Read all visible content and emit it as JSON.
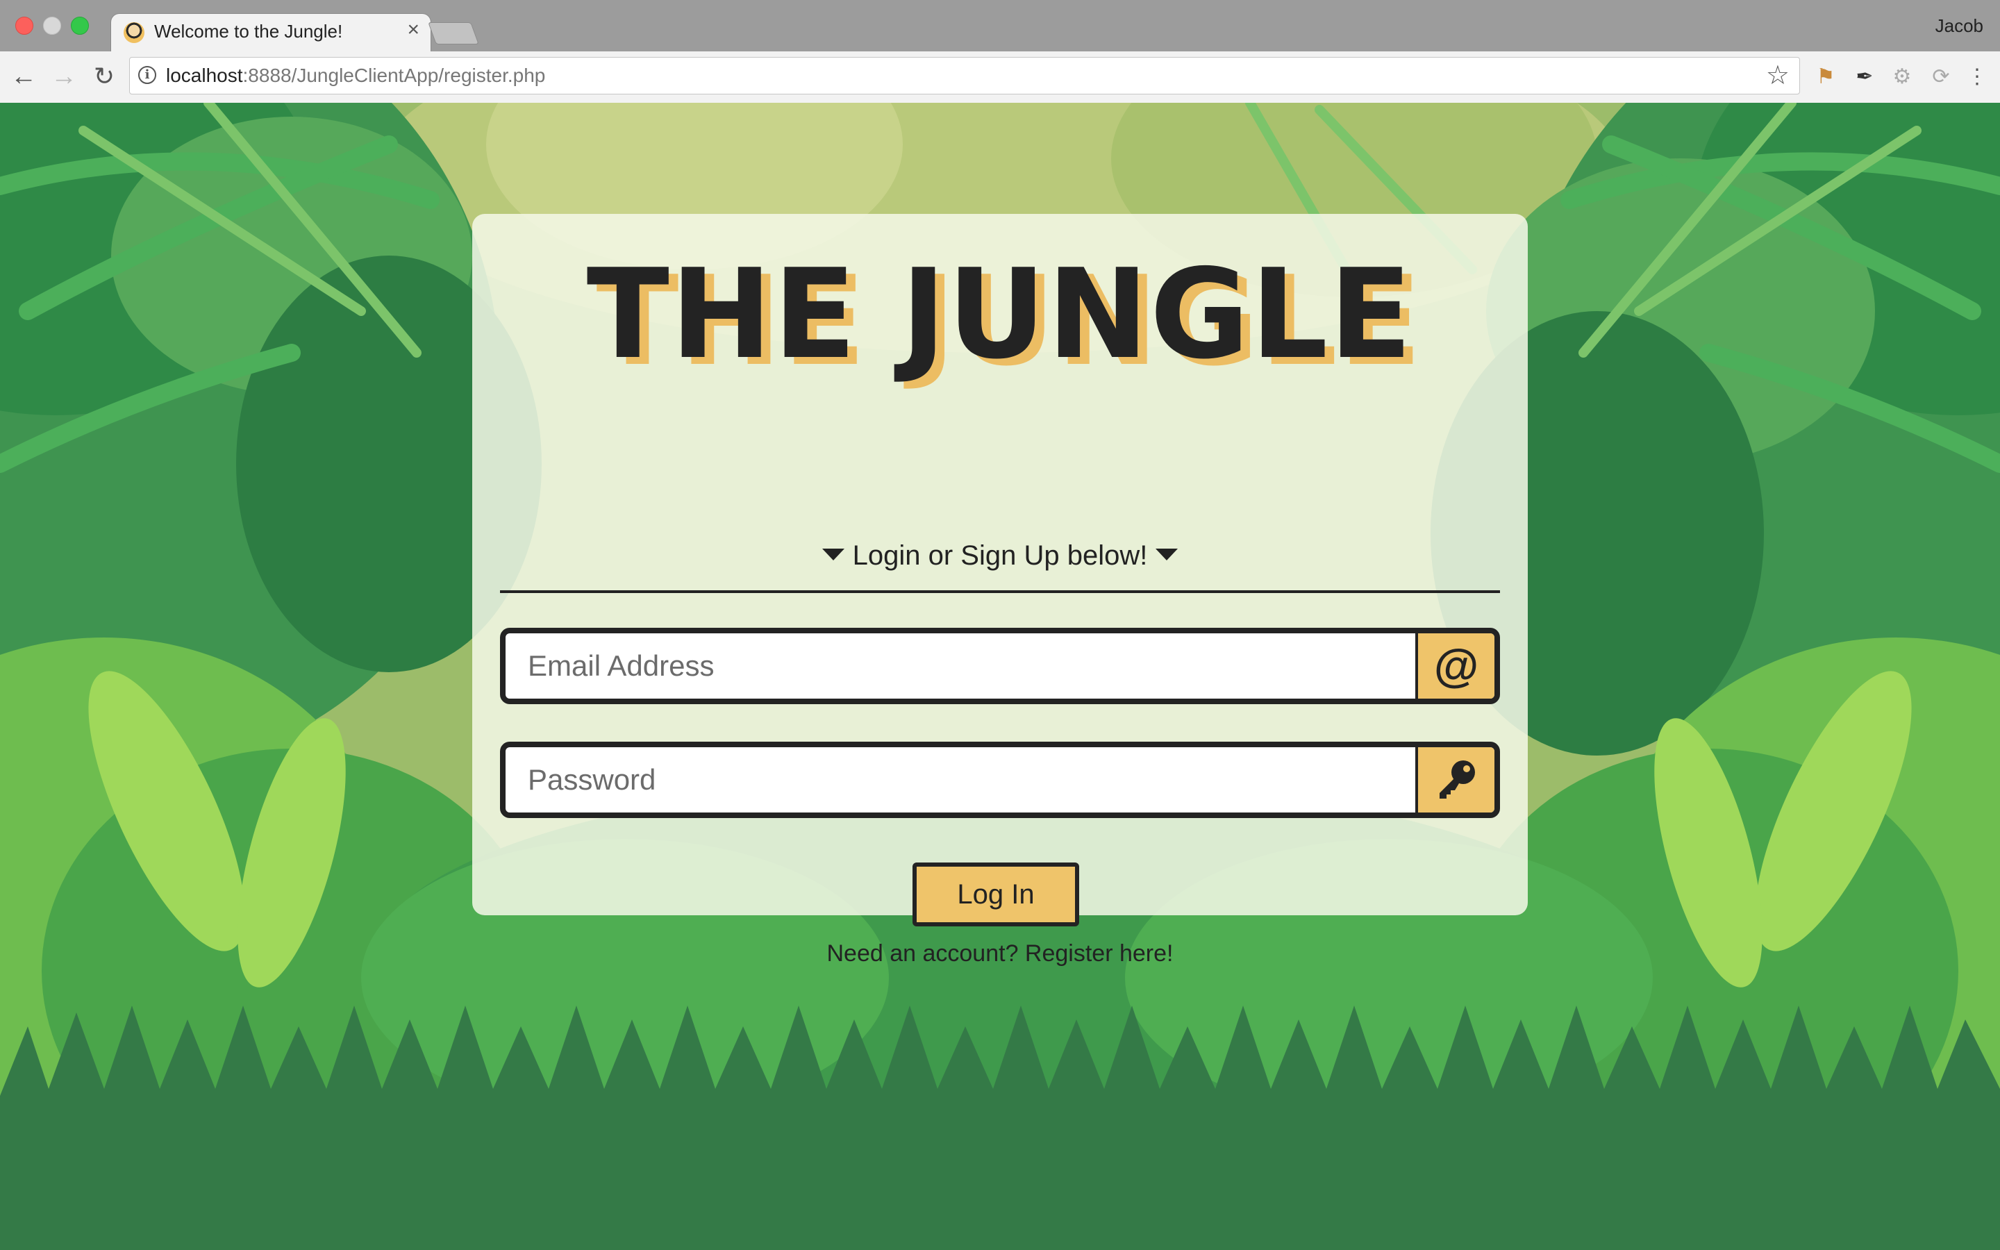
{
  "browser": {
    "tab_title": "Welcome to the Jungle!",
    "tab_close": "×",
    "profile_name": "Jacob",
    "url_host": "localhost",
    "url_rest": ":8888/JungleClientApp/register.php"
  },
  "page": {
    "logo_text": "THE JUNGLE",
    "subtitle": "Login or Sign Up below!",
    "email_placeholder": "Email Address",
    "email_addon": "@",
    "password_placeholder": "Password",
    "login_label": "Log In",
    "register_text": "Need an account? Register here!"
  },
  "icons": {
    "favicon": "monkey-favicon-icon",
    "email_addon": "at-sign-icon",
    "password_addon": "key-icon"
  },
  "colors": {
    "accent": "#efc46a",
    "dark": "#232323",
    "jungle_green": "#347a47",
    "card_bg": "#f4f8e8"
  }
}
